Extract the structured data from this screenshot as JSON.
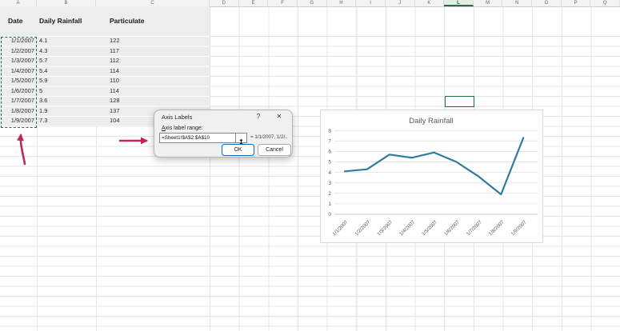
{
  "sheet": {
    "column_letters": [
      "A",
      "B",
      "C",
      "D",
      "E",
      "F",
      "G",
      "H",
      "I",
      "J",
      "K",
      "L",
      "M",
      "N",
      "O",
      "P",
      "Q"
    ],
    "active_column": "L",
    "table": {
      "headers": [
        "Date",
        "Daily Rainfall",
        "Particulate"
      ],
      "rows": [
        [
          "1/1/2007",
          "4.1",
          "122"
        ],
        [
          "1/2/2007",
          "4.3",
          "117"
        ],
        [
          "1/3/2007",
          "5.7",
          "112"
        ],
        [
          "1/4/2007",
          "5.4",
          "114"
        ],
        [
          "1/5/2007",
          "5.9",
          "110"
        ],
        [
          "1/6/2007",
          "5",
          "114"
        ],
        [
          "1/7/2007",
          "3.6",
          "128"
        ],
        [
          "1/8/2007",
          "1.9",
          "137"
        ],
        [
          "1/9/2007",
          "7.3",
          "104"
        ]
      ]
    }
  },
  "dialog": {
    "title": "Axis Labels",
    "help_icon": "?",
    "close_icon": "✕",
    "field_label": "Axis label range:",
    "field_value": "=Sheet1!$A$2:$A$10",
    "range_picker_icon": "↥",
    "preview": "= 1/1/2007, 1/2/..",
    "ok_label": "OK",
    "cancel_label": "Cancel"
  },
  "chart_data": {
    "type": "line",
    "title": "Daily Rainfall",
    "categories": [
      "1/1/2007",
      "1/2/2007",
      "1/3/2007",
      "1/4/2007",
      "1/5/2007",
      "1/6/2007",
      "1/7/2007",
      "1/8/2007",
      "1/9/2007"
    ],
    "values": [
      4.1,
      4.3,
      5.7,
      5.4,
      5.9,
      5,
      3.6,
      1.9,
      7.3
    ],
    "xlabel": "",
    "ylabel": "",
    "ylim": [
      0,
      8
    ],
    "ytick_step": 1,
    "grid": true,
    "legend": null
  },
  "colors": {
    "selection_green": "#1e7145",
    "annotation_pink": "#c2255c",
    "chart_line": "#2e7d9c",
    "ok_border_blue": "#0f6cbd"
  }
}
